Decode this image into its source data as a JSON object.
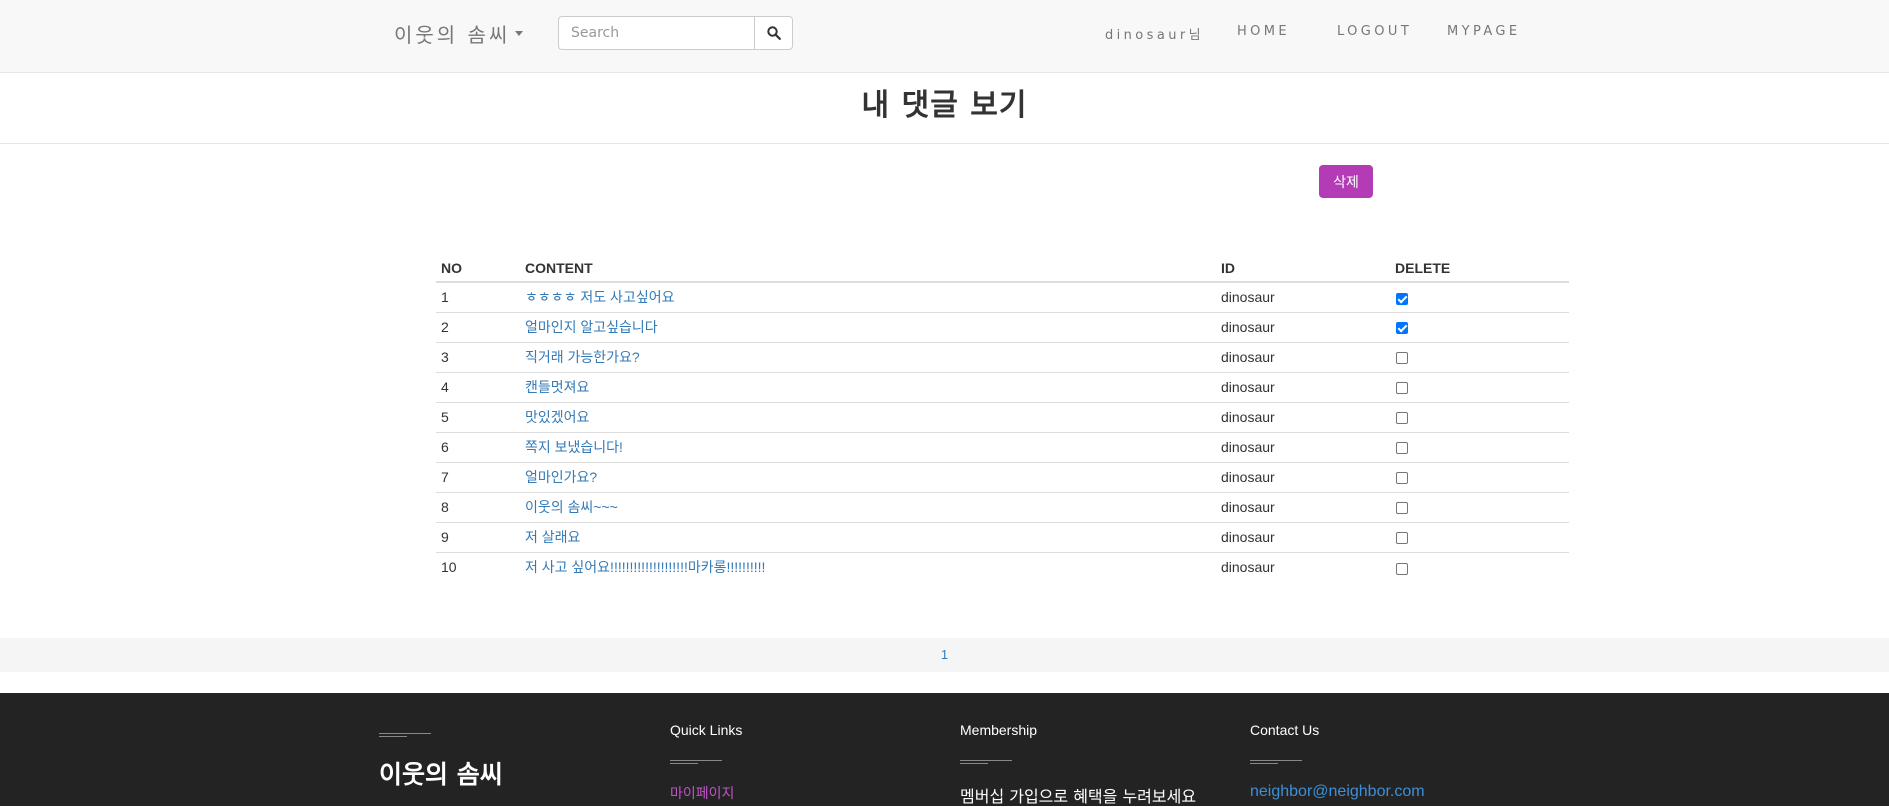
{
  "navbar": {
    "brand": "이웃의 솜씨",
    "search_placeholder": "Search",
    "user": "dinosaur님",
    "home": "HOME",
    "logout": "LOGOUT",
    "mypage": "MYPAGE"
  },
  "page": {
    "title": "내 댓글 보기",
    "delete_button": "삭제"
  },
  "table": {
    "headers": {
      "no": "NO",
      "content": "CONTENT",
      "id": "ID",
      "delete": "DELETE"
    },
    "rows": [
      {
        "no": "1",
        "content": "ㅎㅎㅎㅎ 저도 사고싶어요",
        "id": "dinosaur",
        "checked": true
      },
      {
        "no": "2",
        "content": "얼마인지 알고싶습니다",
        "id": "dinosaur",
        "checked": true
      },
      {
        "no": "3",
        "content": "직거래 가능한가요?",
        "id": "dinosaur",
        "checked": false
      },
      {
        "no": "4",
        "content": "캔들멋져요",
        "id": "dinosaur",
        "checked": false
      },
      {
        "no": "5",
        "content": "맛있겠어요",
        "id": "dinosaur",
        "checked": false
      },
      {
        "no": "6",
        "content": "쪽지 보냈습니다!",
        "id": "dinosaur",
        "checked": false
      },
      {
        "no": "7",
        "content": "얼마인가요?",
        "id": "dinosaur",
        "checked": false
      },
      {
        "no": "8",
        "content": "이웃의 솜씨~~~",
        "id": "dinosaur",
        "checked": false
      },
      {
        "no": "9",
        "content": "저 살래요",
        "id": "dinosaur",
        "checked": false
      },
      {
        "no": "10",
        "content": "저 사고 싶어요!!!!!!!!!!!!!!!!!!!!마카롱!!!!!!!!!!",
        "id": "dinosaur",
        "checked": false
      }
    ]
  },
  "pagination": {
    "current": "1"
  },
  "footer": {
    "logo": "이웃의 솜씨",
    "quick_links_heading": "Quick Links",
    "quick_link_mypage": "마이페이지",
    "membership_heading": "Membership",
    "membership_text": "멤버십 가입으로 혜택을 누려보세요",
    "contact_heading": "Contact Us",
    "contact_email": "neighbor@neighbor.com"
  },
  "colors": {
    "accent": "#b33cb6",
    "link": "#337ab7",
    "footer_bg": "#232323"
  }
}
